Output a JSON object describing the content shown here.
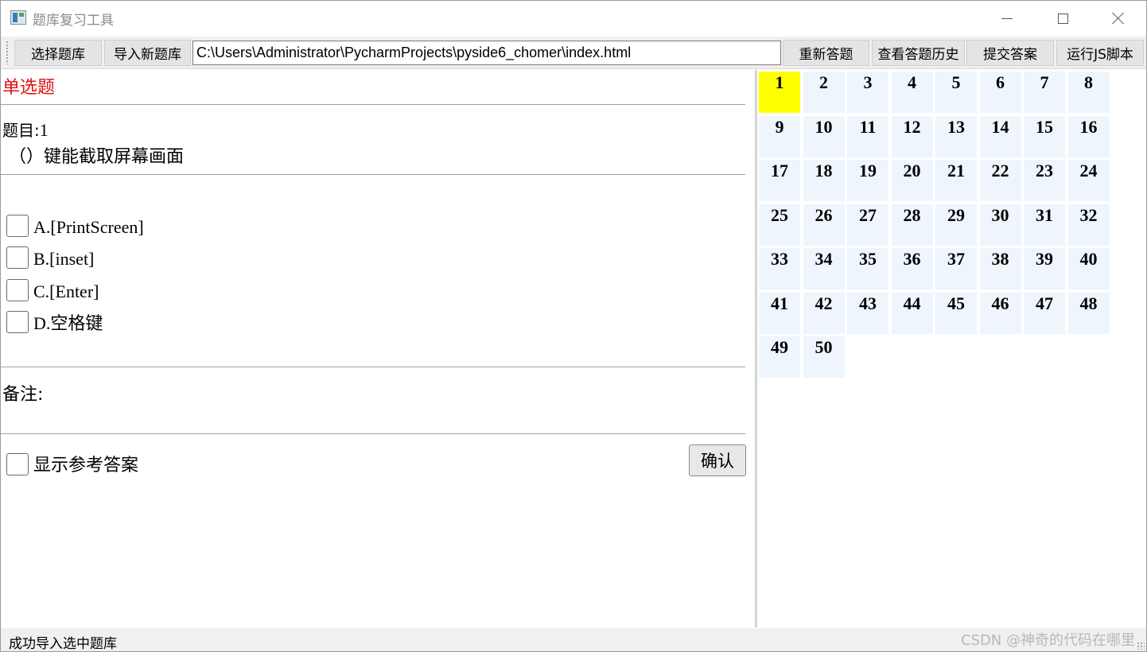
{
  "window": {
    "title": "题库复习工具"
  },
  "toolbar": {
    "select_bank": "选择题库",
    "import_bank": "导入新题库",
    "path_value": "C:\\Users\\Administrator\\PycharmProjects\\pyside6_chomer\\index.html",
    "redo": "重新答题",
    "history": "查看答题历史",
    "submit": "提交答案",
    "run_js": "运行JS脚本"
  },
  "question": {
    "type": "单选题",
    "number_label": "题目:",
    "number": "1",
    "text": "（）键能截取屏幕画面",
    "options": [
      {
        "label": "A.[PrintScreen]"
      },
      {
        "label": "B.[inset]"
      },
      {
        "label": "C.[Enter]"
      },
      {
        "label": "D.空格键"
      }
    ],
    "note_label": "备注:",
    "show_answer": "显示参考答案",
    "confirm": "确认"
  },
  "grid": {
    "numbers": [
      "1",
      "2",
      "3",
      "4",
      "5",
      "6",
      "7",
      "8",
      "9",
      "10",
      "11",
      "12",
      "13",
      "14",
      "15",
      "16",
      "17",
      "18",
      "19",
      "20",
      "21",
      "22",
      "23",
      "24",
      "25",
      "26",
      "27",
      "28",
      "29",
      "30",
      "31",
      "32",
      "33",
      "34",
      "35",
      "36",
      "37",
      "38",
      "39",
      "40",
      "41",
      "42",
      "43",
      "44",
      "45",
      "46",
      "47",
      "48",
      "49",
      "50"
    ],
    "active": "1",
    "active_color": "#ffff00",
    "cell_color": "#eef5fc"
  },
  "status": {
    "message": "成功导入选中题库",
    "watermark": "CSDN @神奇的代码在哪里"
  }
}
